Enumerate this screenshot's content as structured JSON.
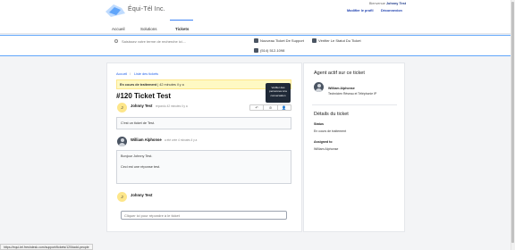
{
  "header": {
    "brand": "Équi-Tél Inc.",
    "welcome_prefix": "Bienvenue",
    "welcome_user": "Johnny Test",
    "profile_link": "Modifier le profil",
    "logout_link": "Déconnexion"
  },
  "nav": {
    "items": [
      "Accueil",
      "Solutions",
      "Tickets"
    ],
    "active": "Tickets"
  },
  "search": {
    "placeholder": "Saisissez votre terme de recherche ici....",
    "actions": [
      "Nouveau Ticket De Support",
      "Vérifier Le Statut Du Ticket",
      "(514) 512-1098"
    ]
  },
  "breadcrumb": [
    "Accueil",
    "Liste des tickets"
  ],
  "ticket": {
    "status_label": "En cours de traitement",
    "status_time": "| 42 minutes il y a",
    "title": "#120 Ticket Test",
    "tooltip": "Verifier des personnes à la conversation",
    "toolbar": [
      "↶",
      "⊘",
      "👤"
    ]
  },
  "messages": [
    {
      "author": "Johnny Test",
      "meta": "répondu 42 minutes il y a",
      "initial": "J",
      "body": [
        "C'est un ticket de Test."
      ]
    },
    {
      "author": "William Alphonse",
      "meta": "a été crée 4 minutes il y a",
      "initial": "",
      "body": [
        "Bonjour Johnny Test.",
        "",
        "Ceci est une réponse test."
      ]
    }
  ],
  "reply": {
    "author": "Johnny Test",
    "initial": "J",
    "placeholder": "Cliquer ici pour répondre à le ticket"
  },
  "side": {
    "agent_heading": "Agent actif sur ce ticket",
    "agent_name": "William Alphonse",
    "agent_role": "Technicien Réseau et Téléphonie IP",
    "details_heading": "Détails du ticket",
    "status_label": "Status",
    "status_value": "En cours de traitement",
    "assigned_label": "Assigned to",
    "assigned_value": "William Alphonse"
  },
  "statusbar": {
    "url": "https://equi-tel.freshdesk.com/support/tickets/120#add-people"
  },
  "colors": {
    "accent": "#2563eb",
    "status_bg": "#fef9c3",
    "avatar_yellow": "#fde68a"
  }
}
